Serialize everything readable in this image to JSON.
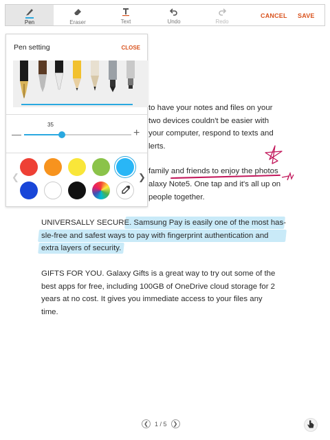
{
  "toolbar": {
    "tools": [
      {
        "label": "Pen",
        "icon": "pen-icon",
        "active": true
      },
      {
        "label": "Eraser",
        "icon": "eraser-icon"
      },
      {
        "label": "Text",
        "icon": "text-icon"
      },
      {
        "label": "Undo",
        "icon": "undo-icon"
      },
      {
        "label": "Redo",
        "icon": "redo-icon",
        "disabled": true
      }
    ],
    "cancel": "CANCEL",
    "save": "SAVE"
  },
  "pen_setting": {
    "title": "Pen setting",
    "close": "CLOSE",
    "size_value": "35",
    "size_fraction": 0.35,
    "colors": [
      "#ee4035",
      "#f7931e",
      "#f9e639",
      "#8bc34a",
      "#29b6f6",
      "#1946d8",
      "#ffffff",
      "#111111",
      "rainbow",
      "eyedropper"
    ],
    "selected_color": "#29b6f6",
    "accent": "#29a8e0"
  },
  "document": {
    "lines_right": [
      "to have your notes and files on your",
      "two devices couldn't be easier with",
      "your computer, respond to texts and",
      "lerts."
    ],
    "lines_right2": [
      "family and friends to enjoy the photos",
      "alaxy Note5. One tap and it's all up on",
      "people together."
    ],
    "paragraph2": [
      "UNIVERSALLY SECURE. Samsung Pay is easily one of the most has-",
      "sle-free and safest ways to pay with fingerprint authentication and",
      "extra layers of security."
    ],
    "paragraph3": [
      "GIFTS FOR YOU. Galaxy Gifts is a great way to try out some of the",
      "best apps for free, including 100GB of OneDrive cloud storage for 2",
      "years at no cost. It gives you immediate access to your files any",
      "time."
    ]
  },
  "pager": {
    "text": "1 / 5"
  }
}
